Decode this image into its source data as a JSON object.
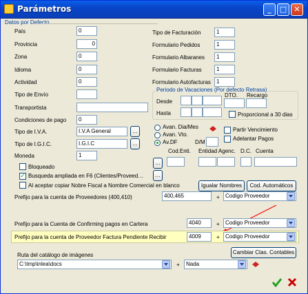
{
  "window": {
    "title": "Parámetros"
  },
  "section": {
    "datos_defecto": "Datos por Defecto"
  },
  "left_fields": {
    "pais": {
      "label": "País",
      "value": "0"
    },
    "provincia": {
      "label": "Provincia",
      "value": "0"
    },
    "zona": {
      "label": "Zona",
      "value": "0"
    },
    "idioma": {
      "label": "Idioma",
      "value": "0"
    },
    "actividad": {
      "label": "Actividad",
      "value": "0"
    },
    "tipo_envio": {
      "label": "Tipo de Envío",
      "value": ""
    },
    "transportista": {
      "label": "Transportista",
      "value": ""
    },
    "condiciones_pago": {
      "label": "Condiciones de pago",
      "value": "0"
    },
    "tipo_iva": {
      "label": "Tipo de I.V.A.",
      "value": "I.V.A General"
    },
    "tipo_igic": {
      "label": "Tipo de I.G.I.C.",
      "value": "I.G.I.C"
    },
    "moneda": {
      "label": "Moneda",
      "value": "1"
    }
  },
  "right_fields": {
    "tipo_facturacion": {
      "label": "Tipo de Facturación",
      "value": "1"
    },
    "form_pedidos": {
      "label": "Formulario Pedidos",
      "value": "1"
    },
    "form_albaranes": {
      "label": "Formulario Albaranes",
      "value": "1"
    },
    "form_facturas": {
      "label": "Formulario Facturas",
      "value": "1"
    },
    "form_autofacturas": {
      "label": "Formulario Autofacturas",
      "value": "1"
    }
  },
  "vacaciones": {
    "title": "Periodo de Vacaciones (Por defecto Retrasa)",
    "desde": "Desde",
    "hasta": "Hasta",
    "dto": "DTO.",
    "recargo": "Recargo",
    "proporcional": "Proporcional a 30 dias",
    "avanz_dia": "Avan. Dia/Mes",
    "avanz_vto": "Avan. Vto.",
    "av_df": "Av.DF",
    "dm": "D/M",
    "partir_vencimiento": "Partir Vencimiento",
    "adelantar_pagos": "Adelantar Pagos"
  },
  "bank": {
    "cod_enti": "Cod.Enti.",
    "entidad_agenc": "Entidad Agenc.",
    "dc": "D.C.",
    "cuenta": "Cuenta"
  },
  "checks": {
    "bloqueado": "Bloqueado",
    "busqueda": "Busqueda ampliada en F6 (Clientes/Proveed…",
    "copiar": "Al aceptar copiar Nobre Fiscal a Nombre Comercial en blanco"
  },
  "buttons": {
    "igualar": "Igualar Nombres",
    "cod_auto": "Cod. Automáticos",
    "cambiar_ctas": "Cambiar Ctas. Contables"
  },
  "prefijos": {
    "proveedores": {
      "label": "Prefijo para la cuenta de Proveedores (400,410)",
      "value": "400,465",
      "select": "Codigo Proveedor"
    },
    "confirming": {
      "label": "Prefijo para la Cuenta de Confirming pagos en Cartera",
      "value": "4040",
      "select": "Codigo Proveedor"
    },
    "pendiente": {
      "label": "Prefijo para la cuenta de Proveedor Factura Pendiente Recibir",
      "value": "4009",
      "select": "Codigo Proveedor"
    },
    "plus": "+"
  },
  "catalogo": {
    "label": "Ruta del catálogo de imágenes",
    "path": "C:\\tmp\\inlea\\docs",
    "select": "Nada",
    "plus": "+"
  },
  "colors": {
    "highlight": "#ffffc0",
    "arrow": "#ff0000",
    "accept": "#21a121",
    "cancel": "#cc0000"
  }
}
